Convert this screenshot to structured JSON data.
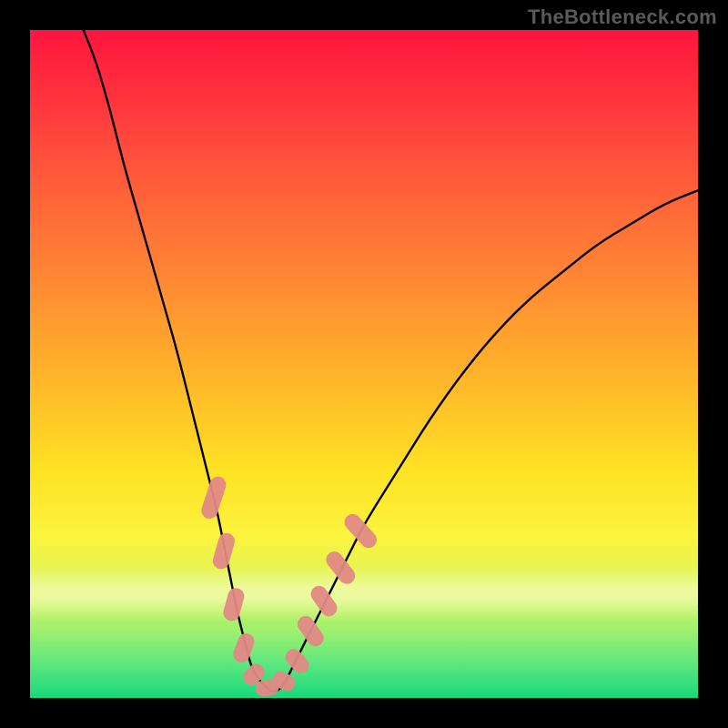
{
  "watermark": "TheBottleneck.com",
  "colors": {
    "background": "#000000",
    "curve_stroke": "#000000",
    "marker_fill": "#e28985",
    "grad_top": "#ff153f",
    "grad_bottom": "#17d87c",
    "band": "#fffed0"
  },
  "chart_data": {
    "type": "line",
    "title": "",
    "xlabel": "",
    "ylabel": "",
    "xlim": [
      0,
      100
    ],
    "ylim": [
      0,
      100
    ],
    "legend": false,
    "grid": false,
    "series": [
      {
        "name": "bottleneck-curve",
        "x": [
          8,
          10,
          12,
          14,
          16,
          18,
          20,
          22,
          24,
          26,
          27,
          28,
          29,
          30,
          31,
          32,
          33,
          34,
          35,
          36,
          37,
          38,
          39,
          40,
          42,
          44,
          46,
          48,
          50,
          55,
          60,
          65,
          70,
          75,
          80,
          85,
          90,
          95,
          100
        ],
        "y": [
          100,
          95,
          88,
          80,
          73,
          66,
          59,
          52,
          44,
          36,
          32,
          28,
          23,
          18,
          13,
          9,
          5,
          3,
          2,
          1,
          1,
          2,
          4,
          6,
          10,
          14,
          18,
          22,
          26,
          34,
          42,
          49,
          55,
          60,
          64,
          68,
          71,
          74,
          76
        ]
      }
    ],
    "markers": {
      "name": "salmon-capsules",
      "points": [
        {
          "x": 27.5,
          "y": 30,
          "angle": -72,
          "len": 6.5
        },
        {
          "x": 29.0,
          "y": 22,
          "angle": -74,
          "len": 5.5
        },
        {
          "x": 30.5,
          "y": 14,
          "angle": -75,
          "len": 5.0
        },
        {
          "x": 32.0,
          "y": 7.5,
          "angle": -70,
          "len": 4.5
        },
        {
          "x": 33.5,
          "y": 3.5,
          "angle": -45,
          "len": 3.5
        },
        {
          "x": 35.5,
          "y": 1.5,
          "angle": -10,
          "len": 3.5
        },
        {
          "x": 38.0,
          "y": 2.5,
          "angle": 25,
          "len": 3.5
        },
        {
          "x": 40.0,
          "y": 5.5,
          "angle": 48,
          "len": 4.0
        },
        {
          "x": 42.0,
          "y": 10,
          "angle": 55,
          "len": 5.0
        },
        {
          "x": 44.0,
          "y": 14.5,
          "angle": 55,
          "len": 5.0
        },
        {
          "x": 46.5,
          "y": 19.5,
          "angle": 52,
          "len": 5.5
        },
        {
          "x": 49.5,
          "y": 25,
          "angle": 48,
          "len": 6.0
        }
      ]
    }
  }
}
